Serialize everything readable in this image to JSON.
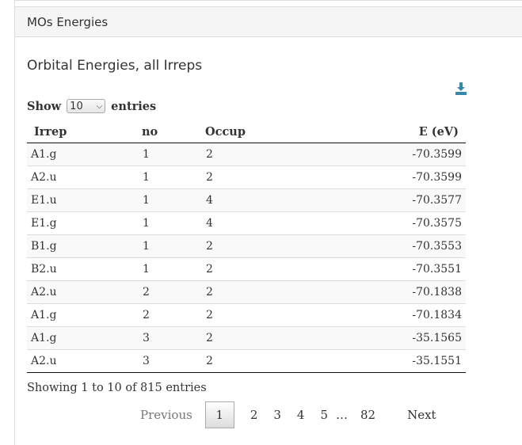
{
  "panel": {
    "heading": "MOs Energies"
  },
  "section": {
    "title": "Orbital Energies, all Irreps"
  },
  "icons": {
    "download": "download-icon"
  },
  "colors": {
    "download_icon": "#3a87ad"
  },
  "length": {
    "show_label": "Show",
    "selected": "10",
    "entries_label": "entries"
  },
  "table": {
    "headers": [
      "Irrep",
      "no",
      "Occup",
      "E (eV)"
    ],
    "rows": [
      [
        "A1.g",
        "1",
        "2",
        "-70.3599"
      ],
      [
        "A2.u",
        "1",
        "2",
        "-70.3599"
      ],
      [
        "E1.u",
        "1",
        "4",
        "-70.3577"
      ],
      [
        "E1.g",
        "1",
        "4",
        "-70.3575"
      ],
      [
        "B1.g",
        "1",
        "2",
        "-70.3553"
      ],
      [
        "B2.u",
        "1",
        "2",
        "-70.3551"
      ],
      [
        "A2.u",
        "2",
        "2",
        "-70.1838"
      ],
      [
        "A1.g",
        "2",
        "2",
        "-70.1834"
      ],
      [
        "A1.g",
        "3",
        "2",
        "-35.1565"
      ],
      [
        "A2.u",
        "3",
        "2",
        "-35.1551"
      ]
    ]
  },
  "info": "Showing 1 to 10 of 815 entries",
  "pagination": {
    "previous": "Previous",
    "pages": [
      "1",
      "2",
      "3",
      "4",
      "5"
    ],
    "ellipsis": "…",
    "last": "82",
    "next": "Next"
  }
}
